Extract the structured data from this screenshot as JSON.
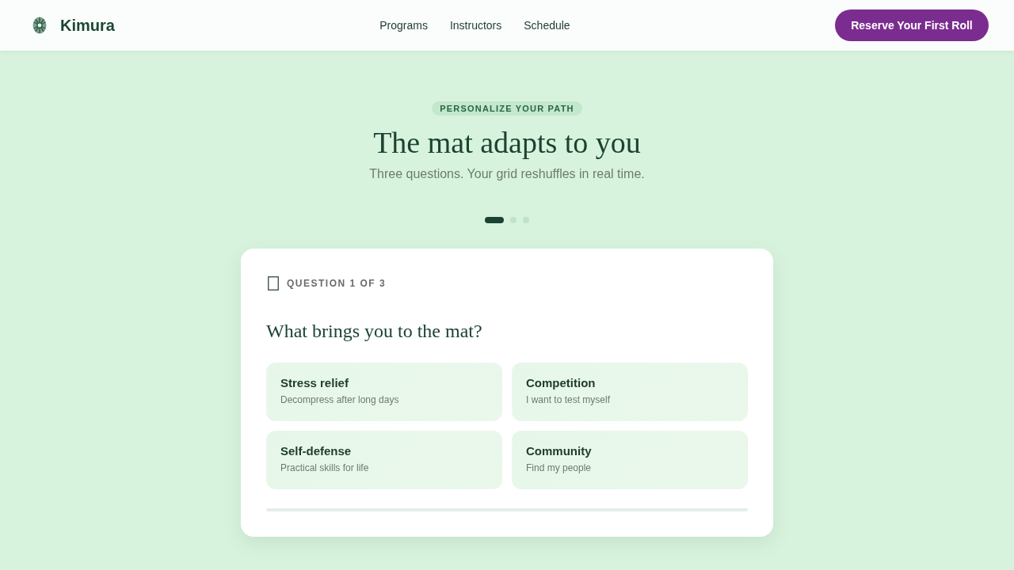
{
  "header": {
    "brand": "Kimura",
    "nav": [
      {
        "label": "Programs"
      },
      {
        "label": "Instructors"
      },
      {
        "label": "Schedule"
      }
    ],
    "cta": "Reserve Your First Roll"
  },
  "hero": {
    "badge": "PERSONALIZE YOUR PATH",
    "title": "The mat adapts to you",
    "subtitle": "Three questions. Your grid reshuffles in real time."
  },
  "steps": [
    {
      "selected": true
    },
    {
      "selected": false
    },
    {
      "selected": false
    }
  ],
  "quiz": {
    "counter": "QUESTION 1 OF 3",
    "question": "What brings you to the mat?",
    "options": [
      {
        "title": "Stress relief",
        "description": "Decompress after long days",
        "selected": false
      },
      {
        "title": "Competition",
        "description": "I want to test myself",
        "selected": false
      },
      {
        "title": "Self-defense",
        "description": "Practical skills for life",
        "selected": false
      },
      {
        "title": "Community",
        "description": "Find my people",
        "selected": false
      }
    ],
    "progress": {
      "level": 0
    }
  }
}
